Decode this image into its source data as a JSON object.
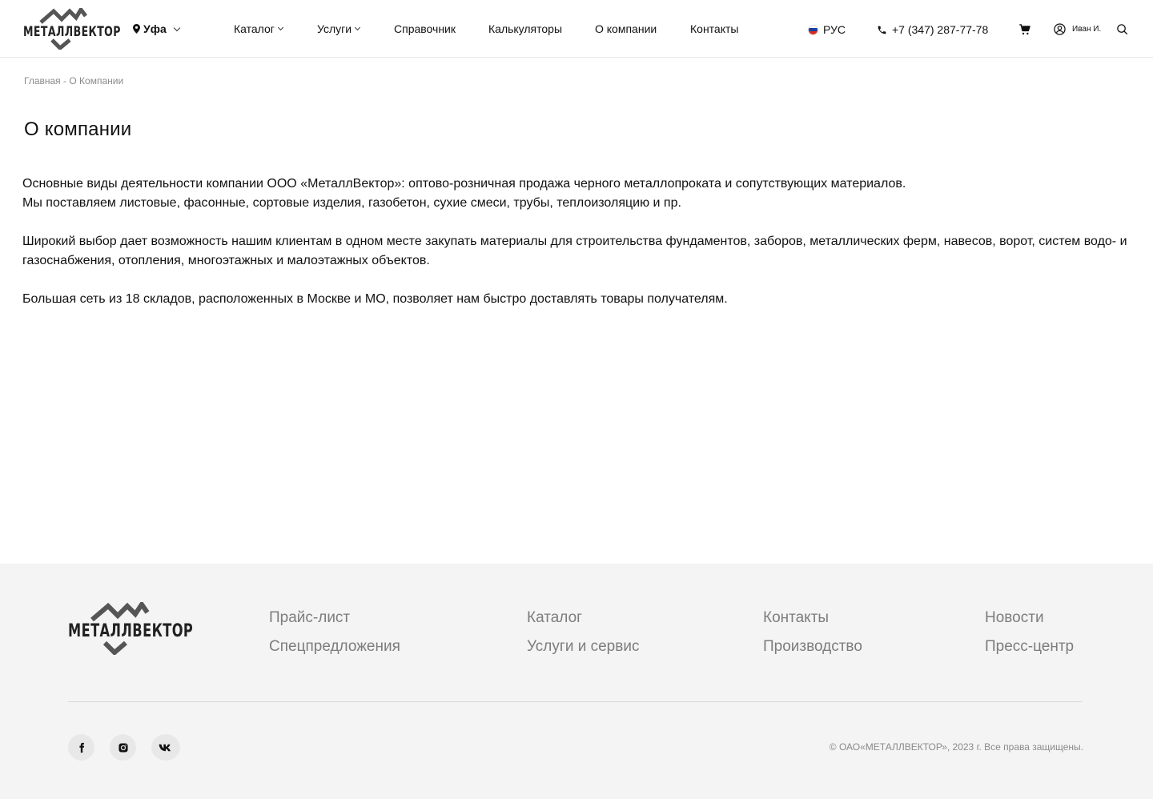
{
  "header": {
    "logo_text": "МЕТАЛЛВЕКТОР",
    "city": "Уфа",
    "nav": [
      {
        "label": "Каталог",
        "has_dropdown": true
      },
      {
        "label": "Услуги",
        "has_dropdown": true
      },
      {
        "label": "Справочник",
        "has_dropdown": false
      },
      {
        "label": "Калькуляторы",
        "has_dropdown": false
      },
      {
        "label": "О компании",
        "has_dropdown": false
      },
      {
        "label": "Контакты",
        "has_dropdown": false
      }
    ],
    "language": "РУС",
    "phone": "+7 (347) 287-77-78",
    "user_name": "Иван И."
  },
  "breadcrumb": {
    "home": "Главная",
    "separator": " - ",
    "current": "О Компании"
  },
  "main": {
    "title": "О компании",
    "paragraphs": [
      "Основные виды деятельности компании ООО «МеталлВектор»: оптово-розничная продажа черного металлопроката и сопутствующих материалов.\nМы поставляем листовые, фасонные, сортовые изделия, газобетон, сухие смеси, трубы, теплоизоляцию и пр.",
      "Широкий выбор дает возможность нашим клиентам в одном месте закупать материалы для строительства фундаментов, заборов, металлических ферм, навесов, ворот, систем водо- и газоснабжения, отопления, многоэтажных и малоэтажных объектов.",
      "Большая сеть из 18 складов, расположенных в Москве и МО, позволяет нам быстро доставлять товары получателям."
    ]
  },
  "footer": {
    "logo_text": "МЕТАЛЛВЕКТОР",
    "links": [
      "Прайс-лист",
      "Спецпредложения",
      "Каталог",
      "Услуги и сервис",
      "Контакты",
      "Производство",
      "Новости",
      "Пресс-центр"
    ],
    "social": [
      {
        "icon": "facebook-icon",
        "glyph": "f"
      },
      {
        "icon": "instagram-icon",
        "glyph": "◎"
      },
      {
        "icon": "vk-icon",
        "glyph": "vk"
      }
    ],
    "copyright": "© ОАО«МЕТАЛЛВЕКТОР», 2023 г. Все права защищены."
  },
  "colors": {
    "text": "#111111",
    "muted": "#8a8a8a",
    "footer_bg": "#f4f4f4",
    "footer_link": "#7d7d7d"
  }
}
